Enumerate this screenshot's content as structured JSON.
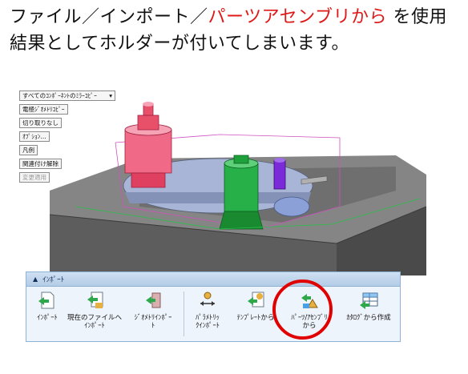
{
  "heading": {
    "line1_part1": "ファイル／インポート／",
    "line1_highlight": "パーツアセンブリから",
    "line1_part2": " を使用",
    "line2": "結果としてホルダーが付いてしまいます。",
    "highlight_color": "#e01818"
  },
  "options_panel": {
    "items": [
      {
        "label": "すべてのｺﾝﾎﾟｰﾈﾝﾄのﾐﾗｰｺﾋﾟｰ",
        "dropdown_icon": "triangle-down"
      },
      {
        "label": "電極ｼﾞｵﾒﾄﾘｺﾋﾟｰ"
      },
      {
        "label": "切り取りなし"
      },
      {
        "label": "ｵﾌﾟｼｮﾝ..."
      },
      {
        "label": "凡例"
      },
      {
        "label": "関連付け解除"
      },
      {
        "label": "変更適用",
        "disabled": true
      }
    ]
  },
  "ribbon": {
    "title": "ｲﾝﾎﾟｰﾄ",
    "collapse_icon": "triangle-up",
    "tools": [
      {
        "label": "ｲﾝﾎﾟｰﾄ",
        "icon": "import-arrow-icon"
      },
      {
        "label": "現在のファイルへ\nｲﾝﾎﾟｰﾄ",
        "icon": "import-to-file-icon"
      },
      {
        "label": "ｼﾞｵﾒﾄﾘｲﾝﾎﾟｰ\nﾄ",
        "icon": "geometry-import-icon"
      },
      {
        "label": "ﾊﾟﾗﾒﾄﾘｯ\nｸｲﾝﾎﾟｰﾄ",
        "icon": "parametric-import-icon"
      },
      {
        "label": "ﾃﾝﾌﾟﾚｰﾄから",
        "icon": "template-icon"
      },
      {
        "label": "ﾊﾟｰﾂ/ｱｾﾝﾌﾞﾘ\nから",
        "icon": "parts-assembly-icon"
      },
      {
        "label": "ｶﾀﾛｸﾞから作成",
        "icon": "catalog-icon"
      }
    ]
  },
  "colors": {
    "ring": "#e00000",
    "holder_red": "#e8506a",
    "electrode_green": "#1ea03a",
    "electrode_purple": "#7a2ad8",
    "plate_blue": "#9aa8c8",
    "block_gray": "#6d6d6d"
  }
}
